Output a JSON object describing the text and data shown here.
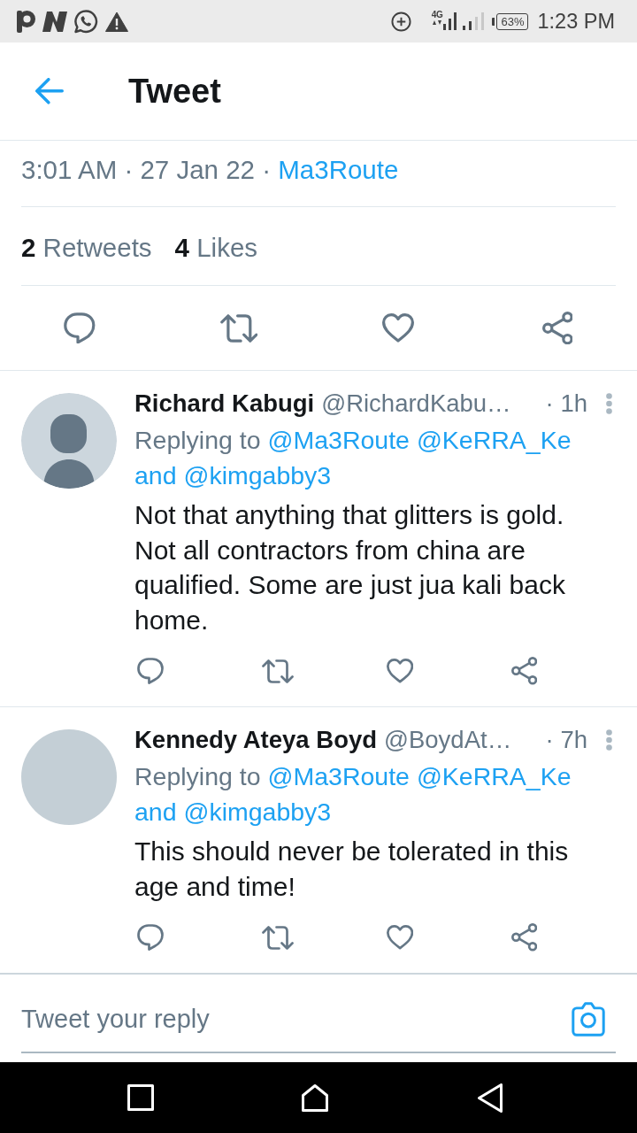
{
  "status_bar": {
    "network": "4G",
    "battery": "63%",
    "time": "1:23 PM"
  },
  "header": {
    "title": "Tweet"
  },
  "tweet": {
    "timestamp": "3:01 AM · 27 Jan 22 ·",
    "source": "Ma3Route",
    "stats": [
      "**2** Retweets",
      "**4** Likes"
    ]
  },
  "replies": [
    {
      "kind": "silhouette",
      "name": "Richard Kabugi",
      "handle": "@RichardKabu…",
      "time": "· 1h",
      "replying_label": "Replying to",
      "mentions": [
        "@Ma3Route",
        "@KeRRA_Ke",
        "and @kimgabby3"
      ],
      "text": "Not that anything that glitters is gold. Not all contractors from china are qualified. Some are just jua kali back home."
    },
    {
      "kind": "blank",
      "name": "Kennedy Ateya Boyd",
      "handle": "@BoydAt…",
      "time": "· 7h",
      "replying_label": "Replying to",
      "mentions": [
        "@Ma3Route",
        "@KeRRA_Ke",
        "and @kimgabby3"
      ],
      "text": "This should never be tolerated in this age and time!"
    }
  ],
  "composer": {
    "placeholder": "Tweet your reply"
  }
}
